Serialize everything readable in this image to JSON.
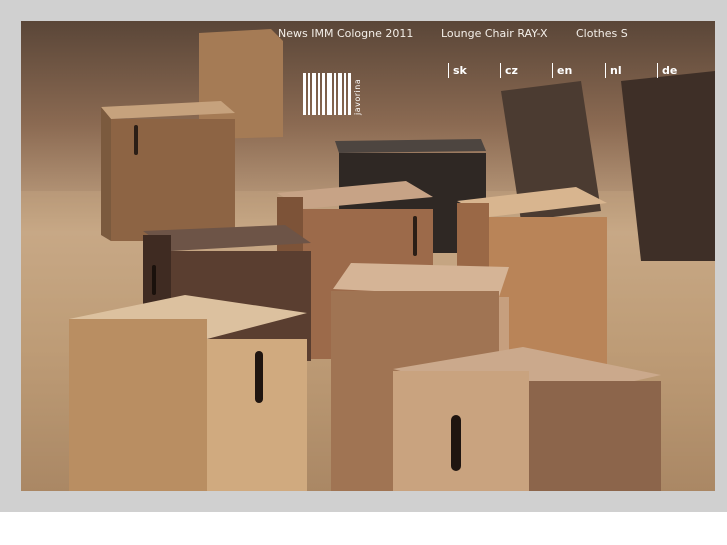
{
  "nav": {
    "items": [
      "News IMM Cologne 2011",
      "Lounge Chair RAY-X",
      "Clothes St"
    ]
  },
  "languages": [
    "sk",
    "cz",
    "en",
    "nl",
    "de"
  ],
  "logo": {
    "brand_text": "javorina"
  },
  "colors": {
    "frame": "#d0d0d0",
    "nav_text": "#f4efe9",
    "wood_light": "#c9a27c",
    "wood_dark": "#4a3a30"
  }
}
